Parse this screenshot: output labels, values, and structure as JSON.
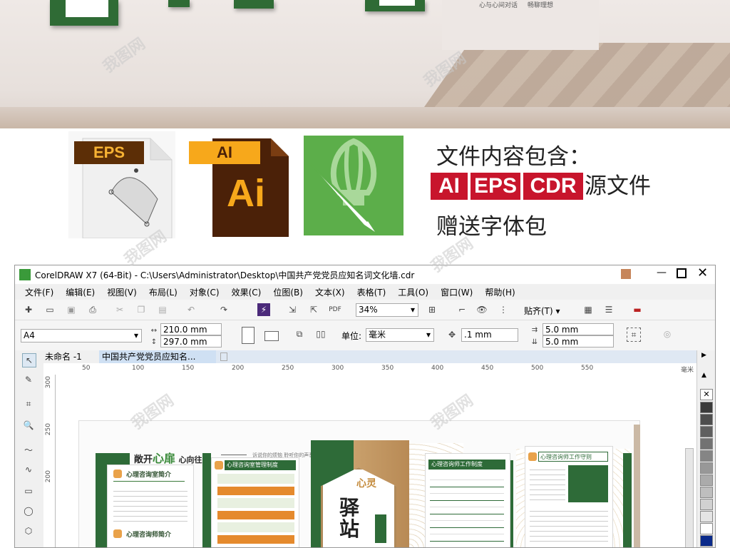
{
  "hero": {
    "title": "文件内容包含：",
    "tags": [
      "AI",
      "EPS",
      "CDR"
    ],
    "tags_suffix": "源文件",
    "line2": "赠送字体包",
    "icons": [
      {
        "name": "eps-file-icon",
        "label": "EPS"
      },
      {
        "name": "ai-file-icon",
        "label": "AI",
        "big": "Ai"
      },
      {
        "name": "cdr-file-icon"
      }
    ],
    "tag_color": "#c8152c"
  },
  "room": {
    "wall_text_1": "心与心间对话",
    "wall_text_2": "畅聊理想"
  },
  "watermark": "我图网",
  "window": {
    "title": "CorelDRAW X7 (64-Bit) - C:\\Users\\Administrator\\Desktop\\中国共产党党员应知名词文化墙.cdr",
    "menu": [
      "文件(F)",
      "编辑(E)",
      "视图(V)",
      "布局(L)",
      "对象(C)",
      "效果(C)",
      "位图(B)",
      "文本(X)",
      "表格(T)",
      "工具(O)",
      "窗口(W)",
      "帮助(H)"
    ],
    "zoom": "34%",
    "snap_label": "贴齐(T)",
    "page_size": "A4",
    "width": "210.0 mm",
    "height": "297.0 mm",
    "unit_label": "单位:",
    "unit": "毫米",
    "nudge": ".1 mm",
    "dup_x": "5.0 mm",
    "dup_y": "5.0 mm",
    "doc_tabs": [
      "未命名 -1",
      "中国共产党党员应知名..."
    ],
    "ruler_h": [
      "50",
      "100",
      "150",
      "200",
      "250",
      "300",
      "350",
      "400",
      "450",
      "500",
      "550"
    ],
    "ruler_unit": "毫米",
    "ruler_v": [
      "300",
      "250",
      "200"
    ],
    "palette": [
      "#3a3a3a",
      "#4d4d4d",
      "#5f5f5f",
      "#727272",
      "#858585",
      "#989898",
      "#ababab",
      "#bebebe",
      "#d1d1d1",
      "#e4e4e4",
      "#ffffff",
      "#0a2a8a"
    ]
  },
  "design": {
    "header_a": "敞开",
    "header_b": "心扉",
    "header_c": "心向往之",
    "header_sub": "诉说你的烦恼 聆听你的声音",
    "panel1_title": "心理咨询室简介",
    "panel1_title2": "心理咨询师简介",
    "panel2_title": "心理咨询室管理制度",
    "center_a": "心灵",
    "center_b": "驿站",
    "panel3_title": "心理咨询师工作制度",
    "panel4_title": "心理咨询师工作守则"
  }
}
